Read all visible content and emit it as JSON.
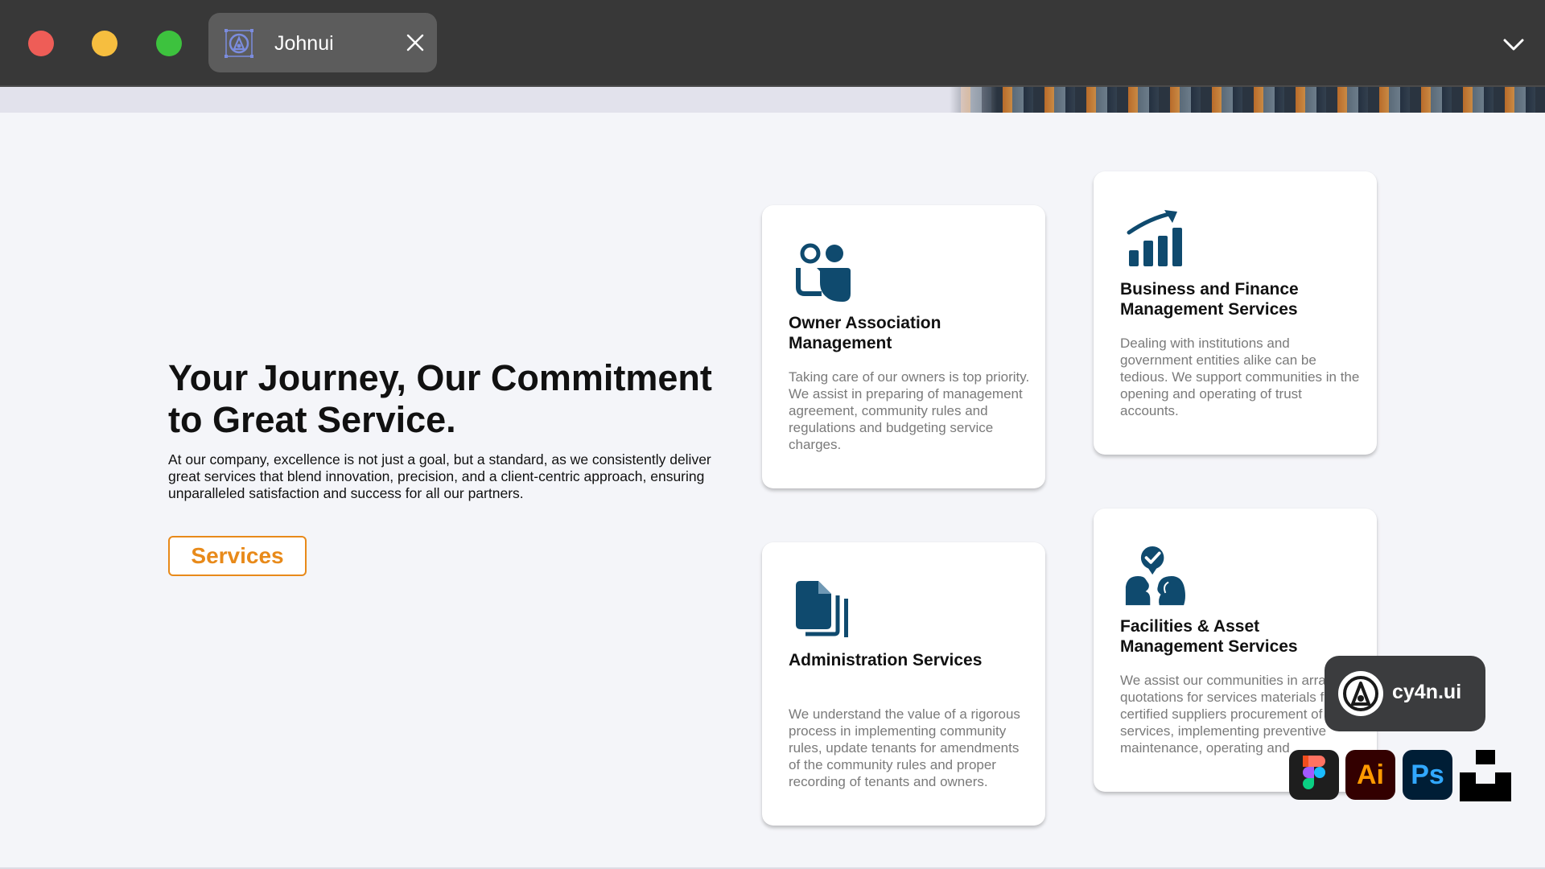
{
  "browser": {
    "tab_title": "Johnui",
    "controls": [
      "close",
      "minimize",
      "maximize"
    ]
  },
  "hero": {
    "title": "Your Journey, Our Commitment to Great Service.",
    "text": "At our company, excellence is not just a goal, but a standard, as we consistently deliver great services that blend innovation, precision, and a client-centric approach, ensuring unparalleled satisfaction and success for all our partners.",
    "button_label": "Services"
  },
  "cards": [
    {
      "icon": "people-icon",
      "title": "Owner Association Management",
      "text": "Taking care of our owners is top priority. We assist in preparing of management agreement, community rules and regulations and budgeting service charges."
    },
    {
      "icon": "growth-chart-icon",
      "title": "Business and Finance Management Services",
      "text": "Dealing with institutions and government entities alike can be tedious. We support communities in the opening and operating of trust accounts."
    },
    {
      "icon": "documents-icon",
      "title": "Administration Services",
      "text": "We understand the value of a rigorous process in implementing community rules, update tenants for amendments of the community rules and proper recording of tenants and owners."
    },
    {
      "icon": "consultation-icon",
      "title": "Facilities & Asset Management Services",
      "text": "We assist our communities in arranging quotations for services materials from certified suppliers procurement of services, implementing preventive maintenance, operating and"
    }
  ],
  "watermark": {
    "brand": "cy4n.ui",
    "tools": [
      "Ai",
      "Ps"
    ]
  },
  "colors": {
    "accent": "#e88a1a",
    "icon": "#0f4a6e",
    "chrome": "#383838",
    "background": "#f4f5f9"
  }
}
